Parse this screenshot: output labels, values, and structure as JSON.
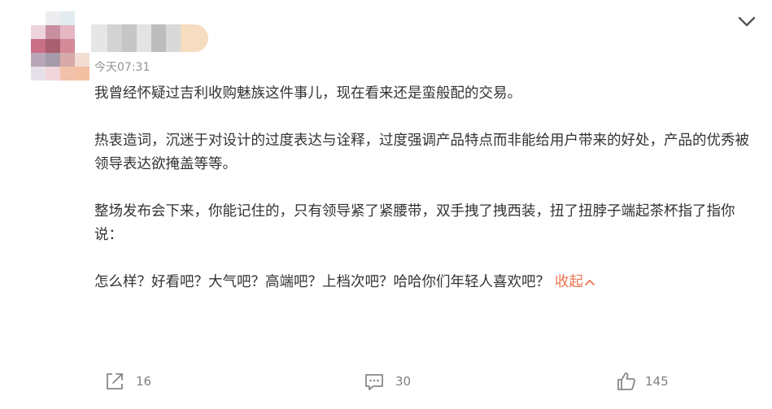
{
  "post": {
    "timestamp": "今天07:31",
    "paragraphs": [
      "我曾经怀疑过吉利收购魅族这件事儿，现在看来还是蛮般配的交易。",
      "热衷造词，沉迷于对设计的过度表达与诠释，过度强调产品特点而非能给用户带来的好处，产品的优秀被领导表达欲掩盖等等。",
      "整场发布会下来，你能记住的，只有领导紧了紧腰带，双手拽了拽西装，扭了扭脖子端起茶杯指了指你说：",
      "怎么样？好看吧？大气吧？高端吧？上档次吧？哈哈你们年轻人喜欢吧？"
    ],
    "collapse_label": "收起",
    "menu_icon": "chevron-down-icon"
  },
  "actions": {
    "share_count": "16",
    "comment_count": "30",
    "like_count": "145"
  },
  "colors": {
    "text": "#333333",
    "muted": "#939393",
    "accent": "#eb7350",
    "icon": "#888888"
  }
}
